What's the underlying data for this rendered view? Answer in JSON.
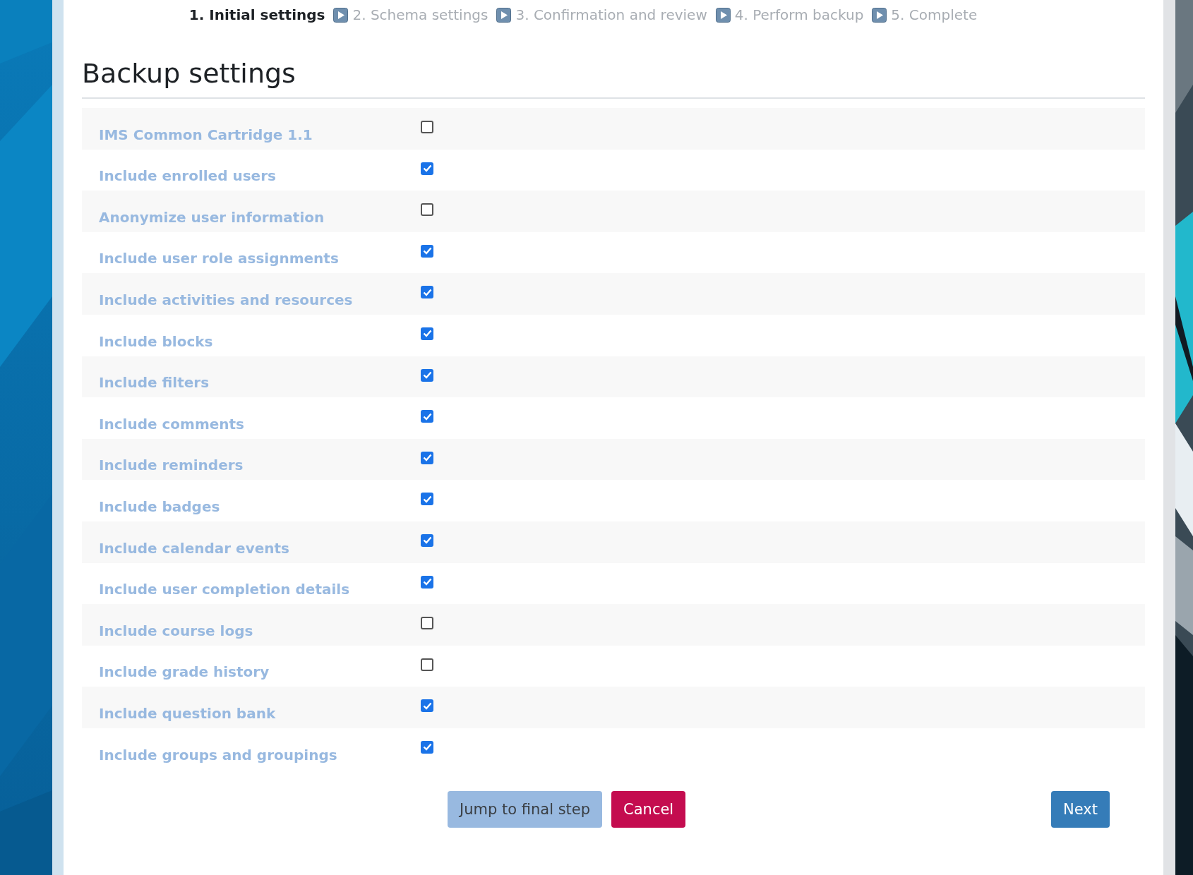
{
  "steps": [
    {
      "label": "1. Initial settings",
      "selected": true
    },
    {
      "label": "2. Schema settings",
      "selected": false
    },
    {
      "label": "3. Confirmation and review",
      "selected": false
    },
    {
      "label": "4. Perform backup",
      "selected": false
    },
    {
      "label": "5. Complete",
      "selected": false
    }
  ],
  "heading": "Backup settings",
  "settings": [
    {
      "label": "IMS Common Cartridge 1.1",
      "checked": false
    },
    {
      "label": "Include enrolled users",
      "checked": true
    },
    {
      "label": "Anonymize user information",
      "checked": false
    },
    {
      "label": "Include user role assignments",
      "checked": true
    },
    {
      "label": "Include activities and resources",
      "checked": true
    },
    {
      "label": "Include blocks",
      "checked": true
    },
    {
      "label": "Include filters",
      "checked": true
    },
    {
      "label": "Include comments",
      "checked": true
    },
    {
      "label": "Include reminders",
      "checked": true
    },
    {
      "label": "Include badges",
      "checked": true
    },
    {
      "label": "Include calendar events",
      "checked": true
    },
    {
      "label": "Include user completion details",
      "checked": true
    },
    {
      "label": "Include course logs",
      "checked": false
    },
    {
      "label": "Include grade history",
      "checked": false
    },
    {
      "label": "Include question bank",
      "checked": true
    },
    {
      "label": "Include groups and groupings",
      "checked": true
    }
  ],
  "buttons": [
    {
      "label": "Jump to final step",
      "kind": "secondary"
    },
    {
      "label": "Cancel",
      "kind": "danger"
    },
    {
      "label": "Next",
      "kind": "primary"
    }
  ]
}
